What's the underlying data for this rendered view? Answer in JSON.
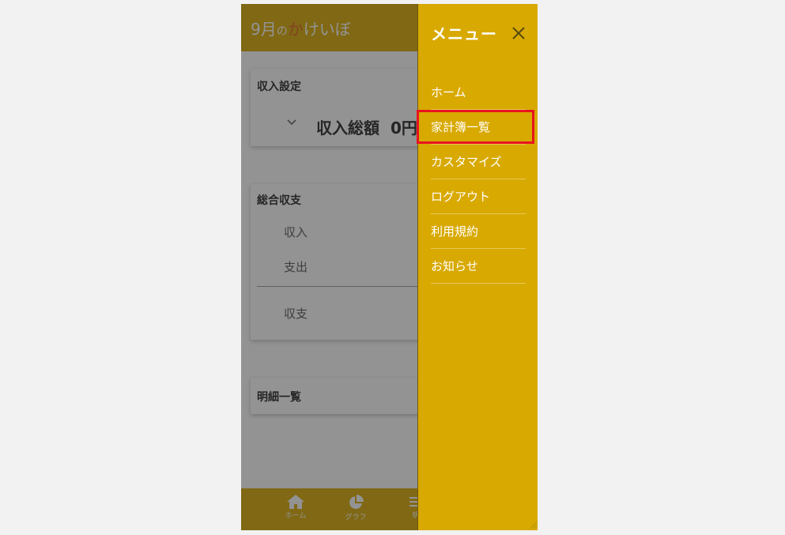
{
  "header": {
    "title_prefix": "9月",
    "title_no": "の",
    "title_ka": "か",
    "title_rest": "けいぼ"
  },
  "income_card": {
    "title": "収入設定",
    "total_label": "収入総額",
    "total_value": "0円"
  },
  "summary_card": {
    "title": "総合収支",
    "rows": [
      "収入",
      "支出",
      "収支"
    ]
  },
  "detail_card": {
    "title": "明細一覧"
  },
  "bottom_nav": {
    "items": [
      {
        "label": "ホーム",
        "icon": "home-icon"
      },
      {
        "label": "グラフ",
        "icon": "pie-chart-icon"
      },
      {
        "label": "明",
        "icon": "list-icon"
      }
    ]
  },
  "drawer": {
    "title": "メニュー",
    "close_icon": "close-icon",
    "items": [
      "ホーム",
      "家計簿一覧",
      "カスタマイズ",
      "ログアウト",
      "利用規約",
      "お知らせ"
    ],
    "highlight_color": "#e8141e"
  },
  "colors": {
    "brand": "#d8a900",
    "accent_ka": "#e05a1c"
  }
}
